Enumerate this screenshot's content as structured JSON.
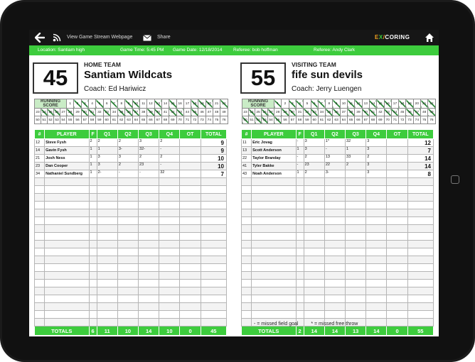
{
  "topbar": {
    "stream_label": "View Game Stream Webpage",
    "share_label": "Share",
    "logo_left": "E",
    "logo_mid": "X",
    "logo_right": "CORING"
  },
  "info": {
    "location": "Location: Santiam high",
    "game_time": "Game Time: 5:45 PM",
    "game_date": "Game Date: 12/18/2014",
    "referee1": "Referee: bob hoffman",
    "referee2": "Referee: Andy Clark"
  },
  "columns": [
    "#",
    "PLAYER",
    "F",
    "Q1",
    "Q2",
    "Q3",
    "Q4",
    "OT",
    "TOTAL"
  ],
  "running_label": "RUNNING SCORE",
  "home": {
    "score": "45",
    "label": "HOME TEAM",
    "name": "Santiam Wildcats",
    "coach": "Coach: Ed Hariwicz",
    "running_hits": [
      2,
      3,
      5,
      7,
      9,
      10,
      13,
      15,
      18,
      19,
      20,
      22,
      24,
      25,
      26,
      28,
      30,
      31,
      33,
      35,
      36,
      37,
      39,
      40,
      42,
      43,
      45
    ],
    "players": [
      {
        "num": "12",
        "name": "Steve Fysh",
        "f": "2",
        "q1": "2",
        "q2": "2",
        "q3": "3",
        "q4": "2",
        "ot": "",
        "total": "9"
      },
      {
        "num": "14",
        "name": "Gavin Fysh",
        "f": "1",
        "q1": "1",
        "q2": "3-",
        "q3": "32-",
        "q4": "-",
        "ot": "",
        "total": "9"
      },
      {
        "num": "21",
        "name": "Josh Ness",
        "f": "1",
        "q1": "3",
        "q2": "3",
        "q3": "2",
        "q4": "2",
        "ot": "",
        "total": "10"
      },
      {
        "num": "23",
        "name": "Dan Cooper",
        "f": "1",
        "q1": "3",
        "q2": "2",
        "q3": "23",
        "q4": "-",
        "ot": "",
        "total": "10"
      },
      {
        "num": "34",
        "name": "Nathaniel Sundberg",
        "f": "1",
        "q1": "2-",
        "q2": "-",
        "q3": "-",
        "q4": "32",
        "ot": "",
        "total": "7"
      }
    ],
    "totals": {
      "label": "TOTALS",
      "f": "6",
      "q1": "11",
      "q2": "10",
      "q3": "14",
      "q4": "10",
      "ot": "0",
      "total": "45"
    }
  },
  "visitor": {
    "score": "55",
    "label": "VISITING TEAM",
    "name": "fife sun devils",
    "coach": "Coach: Jerry Luengen",
    "running_hits": [
      1,
      3,
      4,
      6,
      7,
      9,
      11,
      12,
      14,
      15,
      16,
      18,
      19,
      21,
      22,
      24,
      26,
      27,
      29,
      30,
      32,
      33,
      35,
      36,
      38,
      40,
      41,
      43,
      44,
      46,
      47,
      49,
      50,
      52,
      53,
      55
    ],
    "players": [
      {
        "num": "11",
        "name": "Eric Jovag",
        "f": "-",
        "q1": "3",
        "q2": "1*",
        "q3": "32",
        "q4": "3",
        "ot": "",
        "total": "12"
      },
      {
        "num": "13",
        "name": "Scott Anderson",
        "f": "1",
        "q1": "3",
        "q2": "-",
        "q3": "1",
        "q4": "3",
        "ot": "",
        "total": "7"
      },
      {
        "num": "22",
        "name": "Taylor Branday",
        "f": "-",
        "q1": "2",
        "q2": "13",
        "q3": "33",
        "q4": "2",
        "ot": "",
        "total": "14"
      },
      {
        "num": "41",
        "name": "Tyler Bakke",
        "f": "-",
        "q1": "23",
        "q2": "22",
        "q3": "2",
        "q4": "3",
        "ot": "",
        "total": "14"
      },
      {
        "num": "43",
        "name": "Noah Anderson",
        "f": "1",
        "q1": "2",
        "q2": "3-",
        "q3": "",
        "q4": "3",
        "ot": "",
        "total": "8"
      }
    ],
    "totals": {
      "label": "TOTALS",
      "f": "2",
      "q1": "14",
      "q2": "14",
      "q3": "13",
      "q4": "14",
      "ot": "0",
      "total": "55"
    }
  },
  "legend": {
    "missed_fg": "- = missed field goal",
    "missed_ft": "* = missed free throw"
  },
  "colors": {
    "accent": "#3dcc3d",
    "topbar": "#161616",
    "mark": "#2e8b3a"
  }
}
